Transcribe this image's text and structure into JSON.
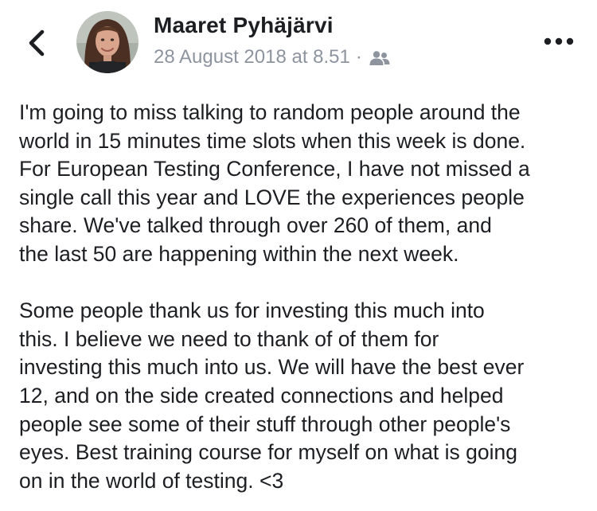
{
  "post": {
    "author": {
      "name": "Maaret Pyhäjärvi",
      "avatar_icon": "profile-photo"
    },
    "meta": {
      "timestamp": "28 August 2018 at 8.51",
      "separator": "·",
      "audience_icon": "friends-icon"
    },
    "nav": {
      "back_icon": "chevron-left-icon",
      "more_icon": "more-options-icon"
    },
    "body": {
      "paragraph1": [
        "I'm going to miss talking to random people around the",
        "world in 15 minutes time slots when this week is done.",
        "For European Testing Conference, I have not missed a",
        "single call this year and LOVE the experiences people",
        "share. We've talked through over 260 of them, and",
        "the last 50 are happening within the next week."
      ],
      "paragraph2": [
        "Some people thank us for investing this much into",
        "this. I believe we need to thank of of them for",
        "investing this much into us. We will have the best ever",
        "12, and on the side created connections and helped",
        "people see some of their stuff through other people's",
        "eyes. Best training course for myself on what is going",
        "on in the world of testing. <3"
      ]
    }
  },
  "colors": {
    "text": "#1c1e21",
    "meta": "#8d949e",
    "background": "#ffffff"
  }
}
